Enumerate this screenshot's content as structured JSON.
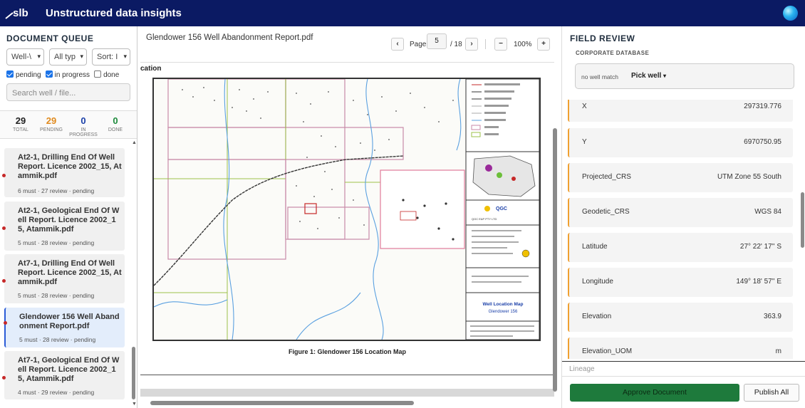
{
  "app": {
    "title": "Unstructured data insights",
    "logo_text": "slb"
  },
  "colors": {
    "header_bg": "#0b1a63",
    "approve_bg": "#1e7a3c",
    "field_accent": "#f0a030",
    "pending_dot": "#c62828"
  },
  "queue": {
    "title": "DOCUMENT QUEUE",
    "filters": [
      "Well-\\",
      "All typ",
      "Sort: I"
    ],
    "checks": [
      {
        "label": "pending",
        "checked": true
      },
      {
        "label": "in progress",
        "checked": true
      },
      {
        "label": "done",
        "checked": false
      }
    ],
    "search_placeholder": "Search well / file...",
    "stats": [
      {
        "value": "29",
        "label": "TOTAL",
        "color": "#222222"
      },
      {
        "value": "29",
        "label": "PENDING",
        "color": "#e08a1e"
      },
      {
        "value": "0",
        "label": "IN PROGRESS",
        "color": "#1a3fa8"
      },
      {
        "value": "0",
        "label": "DONE",
        "color": "#1e8a3c"
      }
    ],
    "items": [
      {
        "title": "At2-1, Drilling End Of Well Report. Licence 2002_15, Atammik.pdf",
        "meta": "6 must · 27 review · pending"
      },
      {
        "title": "At2-1, Geological End Of Well Report. Licence 2002_15, Atammik.pdf",
        "meta": "5 must · 28 review · pending"
      },
      {
        "title": "At7-1, Drilling End Of Well Report. Licence 2002_15, Atammik.pdf",
        "meta": "5 must · 28 review · pending"
      },
      {
        "title": "Glendower 156 Well Abandonment Report.pdf",
        "meta": "5 must · 28 review · pending"
      },
      {
        "title": "At7-1, Geological End Of Well Report. Licence 2002_15, Atammik.pdf",
        "meta": "4 must · 29 review · pending"
      }
    ]
  },
  "viewer": {
    "doc_name": "Glendower 156 Well Abandonment Report.pdf",
    "page_label": "Page",
    "page": "5",
    "page_total": "/ 18",
    "zoom": "100%",
    "prev": "‹",
    "next": "›",
    "zoom_out": "−",
    "zoom_in": "+",
    "top_caption": "cation",
    "figure_caption": "Figure 1: Glendower 156 Location Map",
    "map_title": "Well Location Map",
    "map_subtitle": "Glendower 156",
    "map_logo": "QGC",
    "map_company": "QGC E&P PTY LTD"
  },
  "review": {
    "title": "FIELD REVIEW",
    "db_label": "CORPORATE DATABASE",
    "no_match": "no well match",
    "pick": "Pick well",
    "fields": [
      {
        "key": "X",
        "value": "297319.776"
      },
      {
        "key": "Y",
        "value": "6970750.95"
      },
      {
        "key": "Projected_CRS",
        "value": "UTM Zone 55 South"
      },
      {
        "key": "Geodetic_CRS",
        "value": "WGS 84"
      },
      {
        "key": "Latitude",
        "value": "27° 22' 17'' S"
      },
      {
        "key": "Longitude",
        "value": "149° 18' 57'' E"
      },
      {
        "key": "Elevation",
        "value": "363.9"
      },
      {
        "key": "Elevation_UOM",
        "value": "m"
      }
    ],
    "lineage": "Lineage",
    "approve": "Approve Document",
    "publish": "Publish All"
  }
}
